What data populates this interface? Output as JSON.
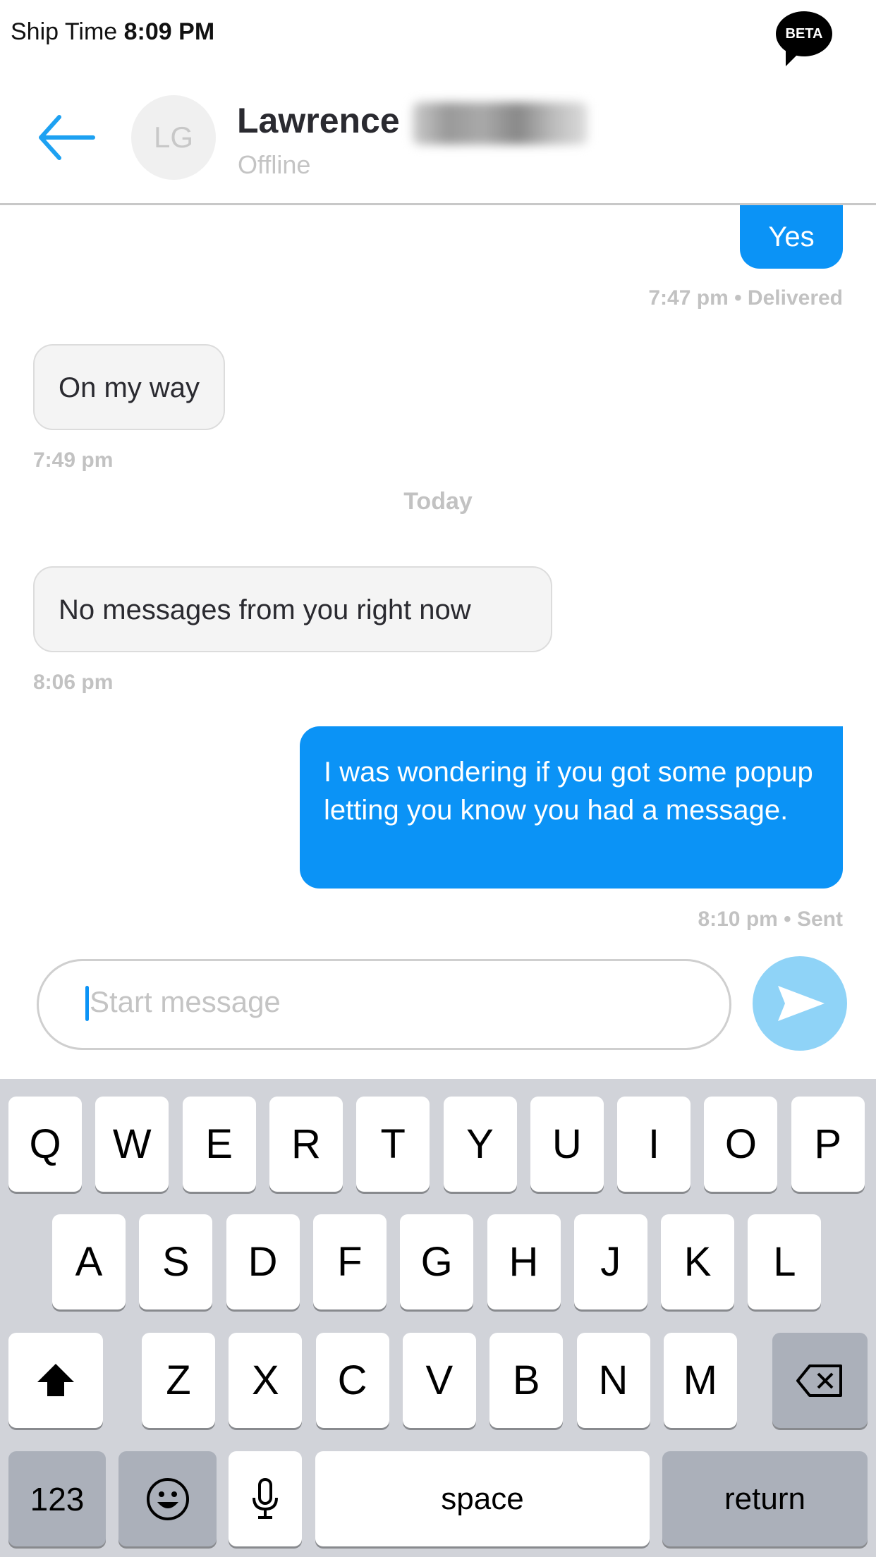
{
  "status_bar": {
    "label": "Ship Time",
    "time": "8:09 PM",
    "badge": "BETA"
  },
  "header": {
    "avatar_initials": "LG",
    "name": "Lawrence",
    "status": "Offline"
  },
  "messages": [
    {
      "direction": "out",
      "text": "Yes",
      "meta": "7:47 pm • Delivered"
    },
    {
      "direction": "in",
      "text": "On my way",
      "meta": "7:49 pm"
    },
    {
      "separator": "Today"
    },
    {
      "direction": "in",
      "text": "No messages from you right now",
      "meta": "8:06 pm"
    },
    {
      "direction": "out",
      "text": "I was wondering if you got some popup letting you know you had a message.",
      "meta": "8:10 pm • Sent"
    }
  ],
  "composer": {
    "placeholder": "Start message",
    "value": ""
  },
  "keyboard": {
    "row1": [
      "Q",
      "W",
      "E",
      "R",
      "T",
      "Y",
      "U",
      "I",
      "O",
      "P"
    ],
    "row2": [
      "A",
      "S",
      "D",
      "F",
      "G",
      "H",
      "J",
      "K",
      "L"
    ],
    "row3": [
      "Z",
      "X",
      "C",
      "V",
      "B",
      "N",
      "M"
    ],
    "numbers": "123",
    "space": "space",
    "return": "return"
  },
  "colors": {
    "accent": "#0b93f6",
    "send_button": "#8fd3f7",
    "keyboard_bg": "#d1d3d9"
  }
}
